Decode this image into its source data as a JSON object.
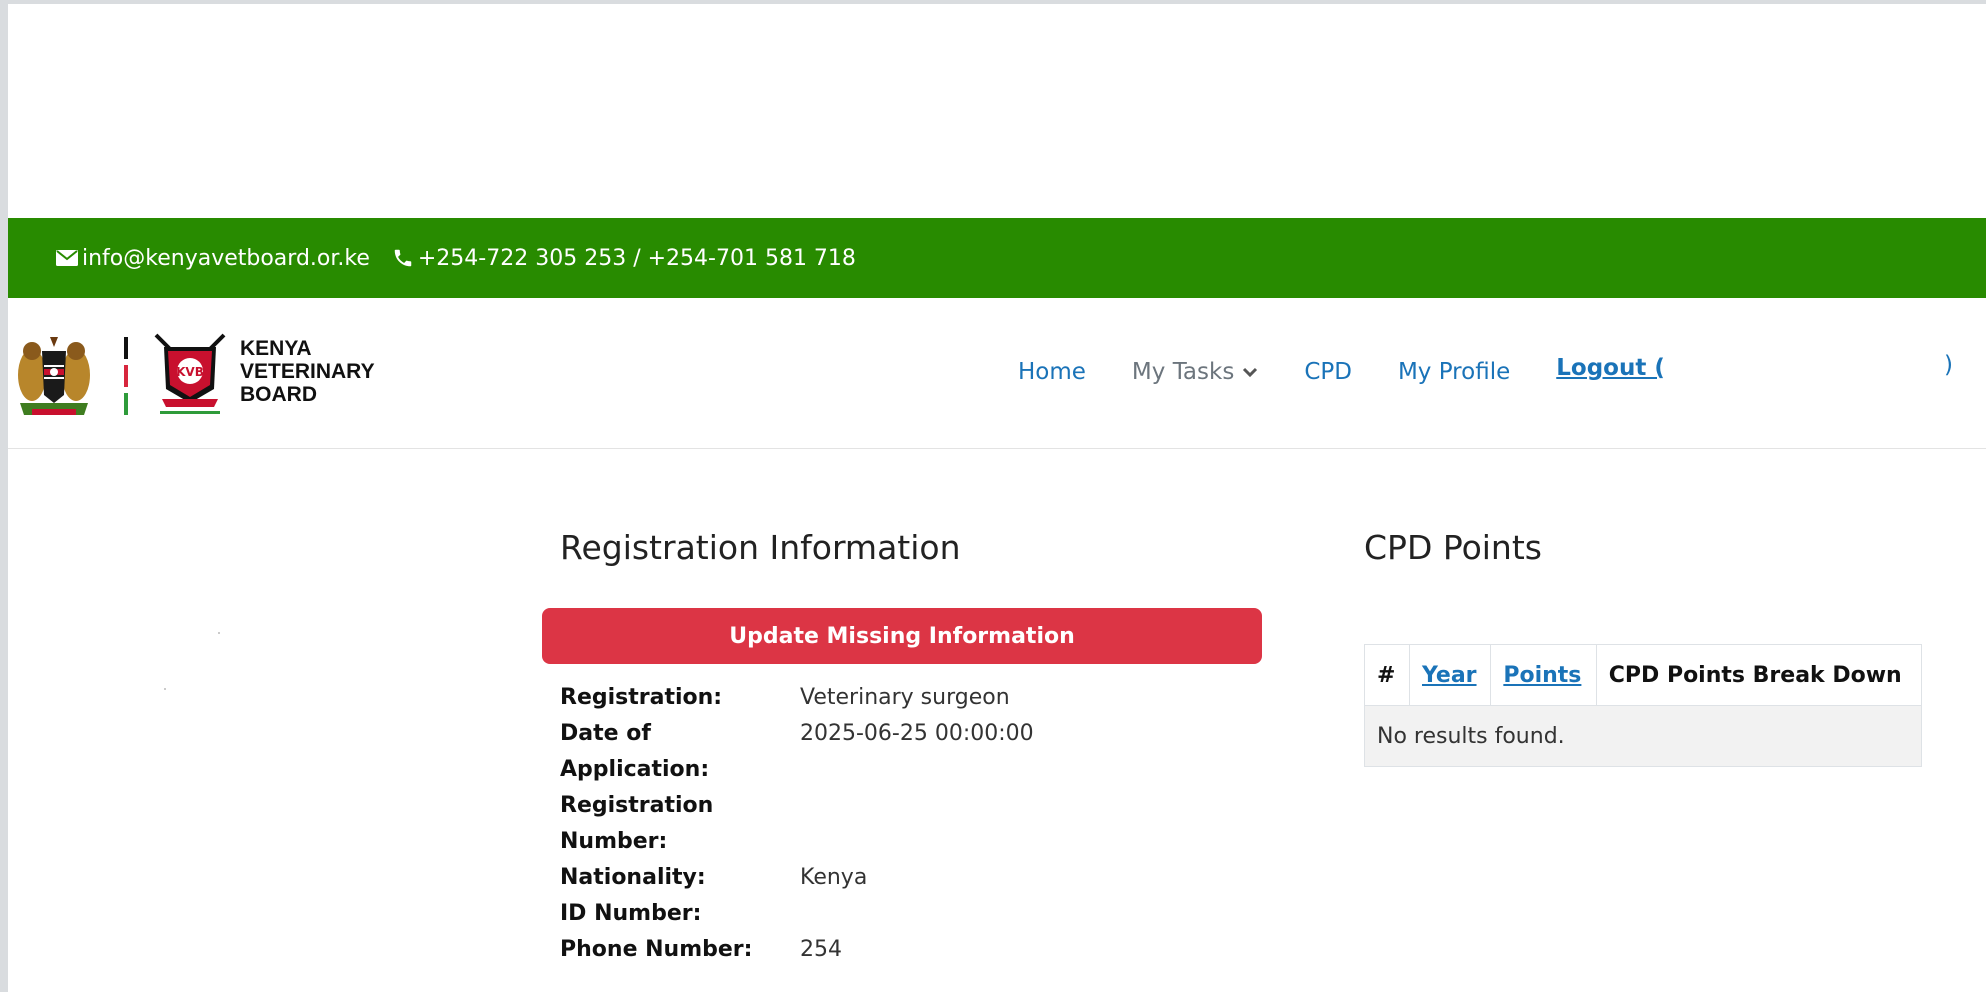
{
  "contact": {
    "email": "info@kenyavetboard.or.ke",
    "phone": "+254-722 305 253 / +254-701 581 718",
    "email_icon": "envelope-icon",
    "phone_icon": "phone-icon"
  },
  "brand": {
    "line1": "KENYA",
    "line2": "VETERINARY",
    "line3": "BOARD"
  },
  "nav": {
    "home": "Home",
    "my_tasks": "My Tasks",
    "cpd": "CPD",
    "my_profile": "My Profile",
    "logout": "Logout (",
    "logout_close": ")"
  },
  "registration": {
    "title": "Registration Information",
    "update_button": "Update Missing Information",
    "rows": [
      {
        "label": "Registration:",
        "value": "Veterinary surgeon"
      },
      {
        "label": "Date of Application:",
        "value": "2025-06-25 00:00:00"
      },
      {
        "label": "Registration Number:",
        "value": ""
      },
      {
        "label": "Nationality:",
        "value": "Kenya"
      },
      {
        "label": "ID Number:",
        "value": ""
      },
      {
        "label": "Phone Number:",
        "value": "254"
      }
    ]
  },
  "cpd_points": {
    "title": "CPD Points",
    "columns": [
      "#",
      "Year",
      "Points",
      "CPD Points Break Down"
    ],
    "empty_message": "No results found."
  },
  "colors": {
    "topbar": "#288b00",
    "link": "#1a73b8",
    "danger_button": "#dc3545"
  }
}
